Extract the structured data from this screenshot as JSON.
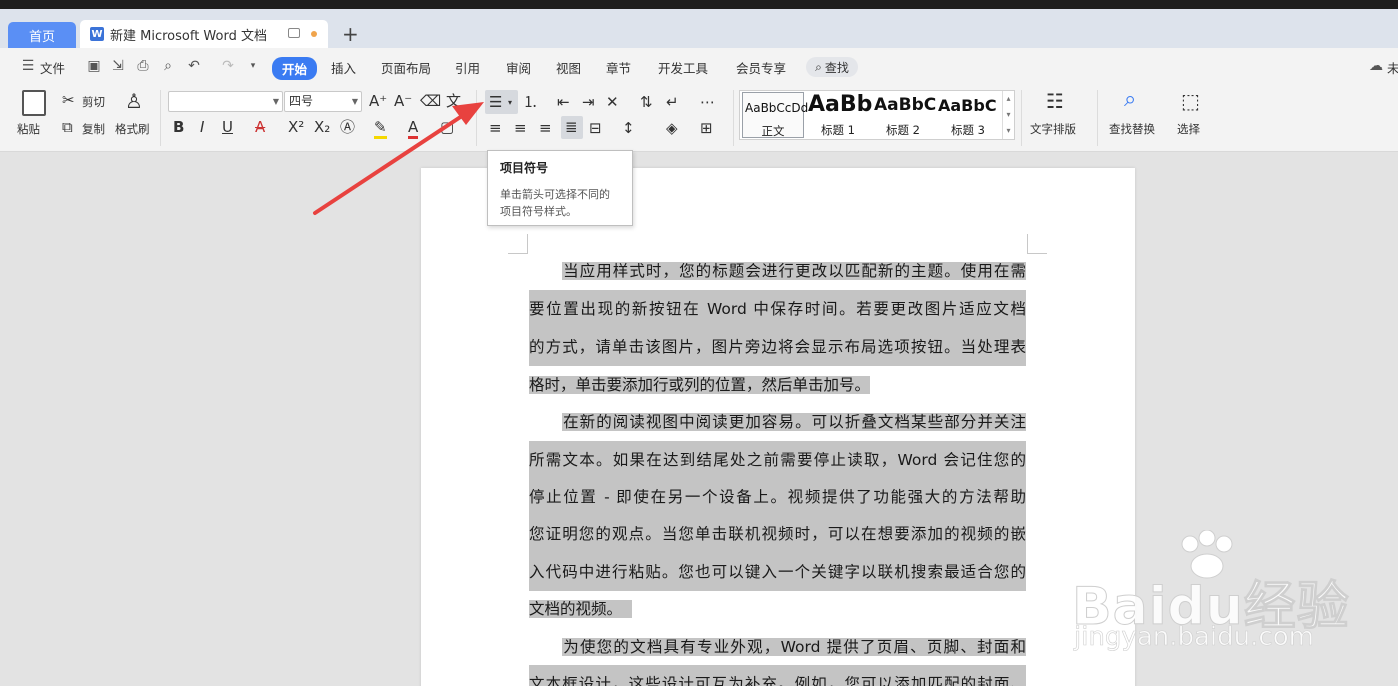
{
  "tabs": {
    "home_label": "首页",
    "doc_icon": "W",
    "doc_title": "新建 Microsoft Word 文档",
    "new_tab": "+"
  },
  "menubar": {
    "file_label": "文件",
    "items": [
      "开始",
      "插入",
      "页面布局",
      "引用",
      "审阅",
      "视图",
      "章节",
      "开发工具",
      "会员专享"
    ],
    "search_label": "查找",
    "right_label": "未"
  },
  "ribbon": {
    "paste": "粘贴",
    "cut": "剪切",
    "copy": "复制",
    "format_painter": "格式刷",
    "font_name": "",
    "font_size": "四号",
    "styles": [
      {
        "sample": "AaBbCcDd",
        "name": "正文"
      },
      {
        "sample": "AaBb",
        "name": "标题 1"
      },
      {
        "sample": "AaBbC",
        "name": "标题 2"
      },
      {
        "sample": "AaBbC",
        "name": "标题 3"
      }
    ],
    "text_layout": "文字排版",
    "find_replace": "查找替换",
    "select": "选择"
  },
  "tooltip": {
    "title": "项目符号",
    "line1": "单击箭头可选择不同的",
    "line2": "项目符号样式。"
  },
  "document": {
    "lines": [
      "当应用样式时，您的标题会进行更改以匹配新的主题。使用在需",
      "要位置出现的新按钮在 Word 中保存时间。若要更改图片适应文档",
      "的方式，请单击该图片，图片旁边将会显示布局选项按钮。当处理表",
      "格时，单击要添加行或列的位置，然后单击加号。",
      "在新的阅读视图中阅读更加容易。可以折叠文档某些部分并关注",
      "所需文本。如果在达到结尾处之前需要停止读取，Word 会记住您的",
      "停止位置 - 即使在另一个设备上。视频提供了功能强大的方法帮助",
      "您证明您的观点。当您单击联机视频时，可以在想要添加的视频的嵌",
      "入代码中进行粘贴。您也可以键入一个关键字以联机搜索最适合您的",
      "文档的视频。",
      "为使您的文档具有专业外观，Word 提供了页眉、页脚、封面和",
      "文本框设计，这些设计可互为补充。例如，您可以添加匹配的封面、"
    ]
  },
  "watermark": {
    "brand": "Baidu经验",
    "url": "jingyan.baidu.com"
  },
  "colors": {
    "accent": "#3a7bf2",
    "home_tab": "#5a8ff5",
    "highlight": "#c4c4c4",
    "arrow": "#e8423f"
  }
}
